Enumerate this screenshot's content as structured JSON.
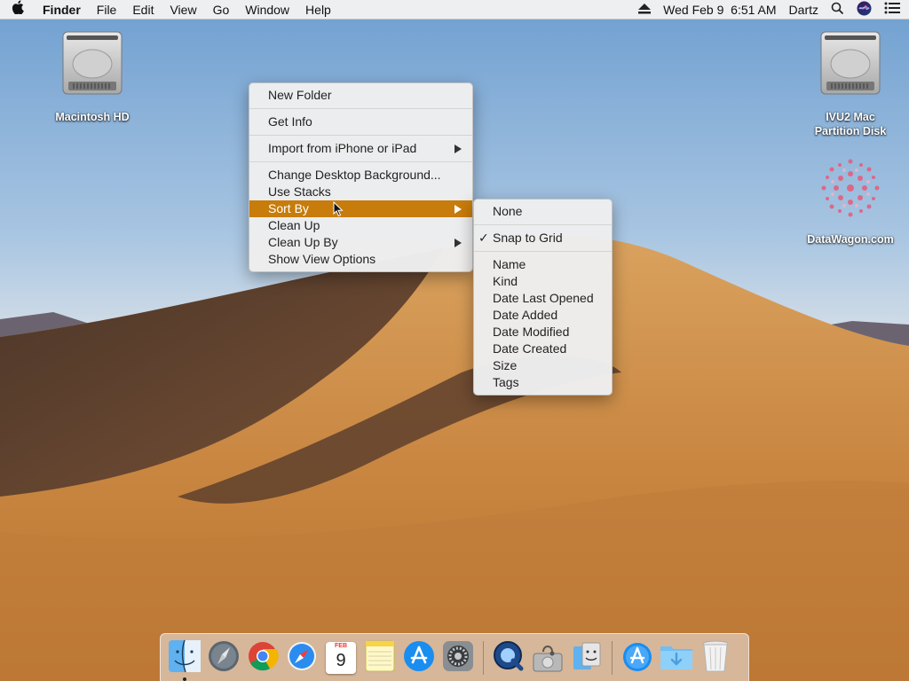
{
  "menubar": {
    "app_name": "Finder",
    "menus": [
      "File",
      "Edit",
      "View",
      "Go",
      "Window",
      "Help"
    ],
    "clock": "Wed Feb 9  6:51 AM",
    "user": "Dartz",
    "icons": [
      "apple-icon",
      "eject-icon",
      "spotlight-icon",
      "siri-icon",
      "notification-center-icon"
    ]
  },
  "desktop": {
    "icons": [
      {
        "label": "Macintosh HD",
        "icon": "hard-disk-icon"
      },
      {
        "label_line1": "IVU2 Mac",
        "label_line2": "Partition Disk",
        "icon": "hard-disk-icon"
      },
      {
        "label": "DataWagon.com",
        "icon": "datawagon-logo-icon"
      }
    ]
  },
  "context_menu": {
    "items": [
      {
        "label": "New Folder"
      },
      {
        "label": "Get Info"
      },
      {
        "label": "Import from iPhone or iPad",
        "submenu": true
      },
      {
        "label": "Change Desktop Background..."
      },
      {
        "label": "Use Stacks"
      },
      {
        "label": "Sort By",
        "submenu": true,
        "highlighted": true
      },
      {
        "label": "Clean Up"
      },
      {
        "label": "Clean Up By",
        "submenu": true
      },
      {
        "label": "Show View Options"
      }
    ],
    "highlight_color": "#c77c0b"
  },
  "sort_submenu": {
    "items": [
      {
        "label": "None"
      },
      {
        "label": "Snap to Grid",
        "checked": true
      },
      {
        "label": "Name"
      },
      {
        "label": "Kind"
      },
      {
        "label": "Date Last Opened"
      },
      {
        "label": "Date Added"
      },
      {
        "label": "Date Modified"
      },
      {
        "label": "Date Created"
      },
      {
        "label": "Size"
      },
      {
        "label": "Tags"
      }
    ],
    "check_mark": "✓"
  },
  "dock": {
    "apps": [
      "finder-icon",
      "launchpad-icon",
      "chrome-icon",
      "safari-icon",
      "calendar-icon",
      "notes-icon",
      "app-store-icon",
      "system-preferences-icon",
      "quicktime-icon",
      "disk-utility-icon",
      "migration-assistant-icon",
      "applications-folder-icon",
      "downloads-folder-icon",
      "trash-icon"
    ],
    "calendar_month": "FEB",
    "calendar_day": "9"
  }
}
